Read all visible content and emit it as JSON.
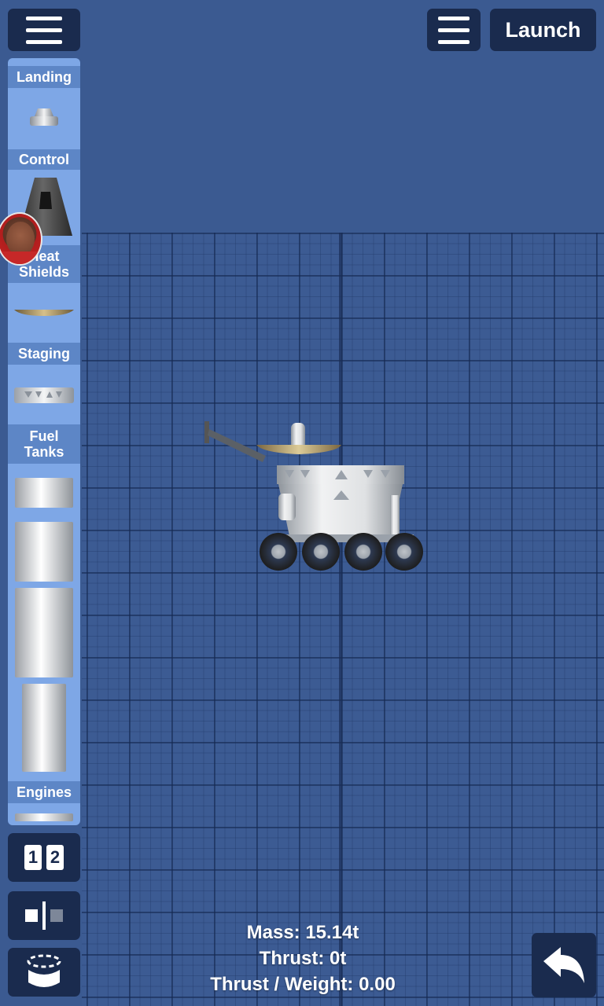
{
  "top_bar": {
    "launch_label": "Launch"
  },
  "sidebar": {
    "categories": [
      {
        "label": "Landing"
      },
      {
        "label": "Control"
      },
      {
        "label": "Heat\nShields"
      },
      {
        "label": "Staging"
      },
      {
        "label": "Fuel\nTanks"
      },
      {
        "label": "Engines"
      }
    ]
  },
  "tools": {
    "stage_numbers": [
      "1",
      "2"
    ]
  },
  "stats": {
    "mass": "Mass: 15.14t",
    "thrust": "Thrust: 0t",
    "thrust_weight": "Thrust / Weight: 0.00"
  },
  "colors": {
    "background": "#3b5a91",
    "button": "#1a2b4e",
    "sidebar": "#7ea7e6",
    "category_header": "#5d86c6"
  }
}
